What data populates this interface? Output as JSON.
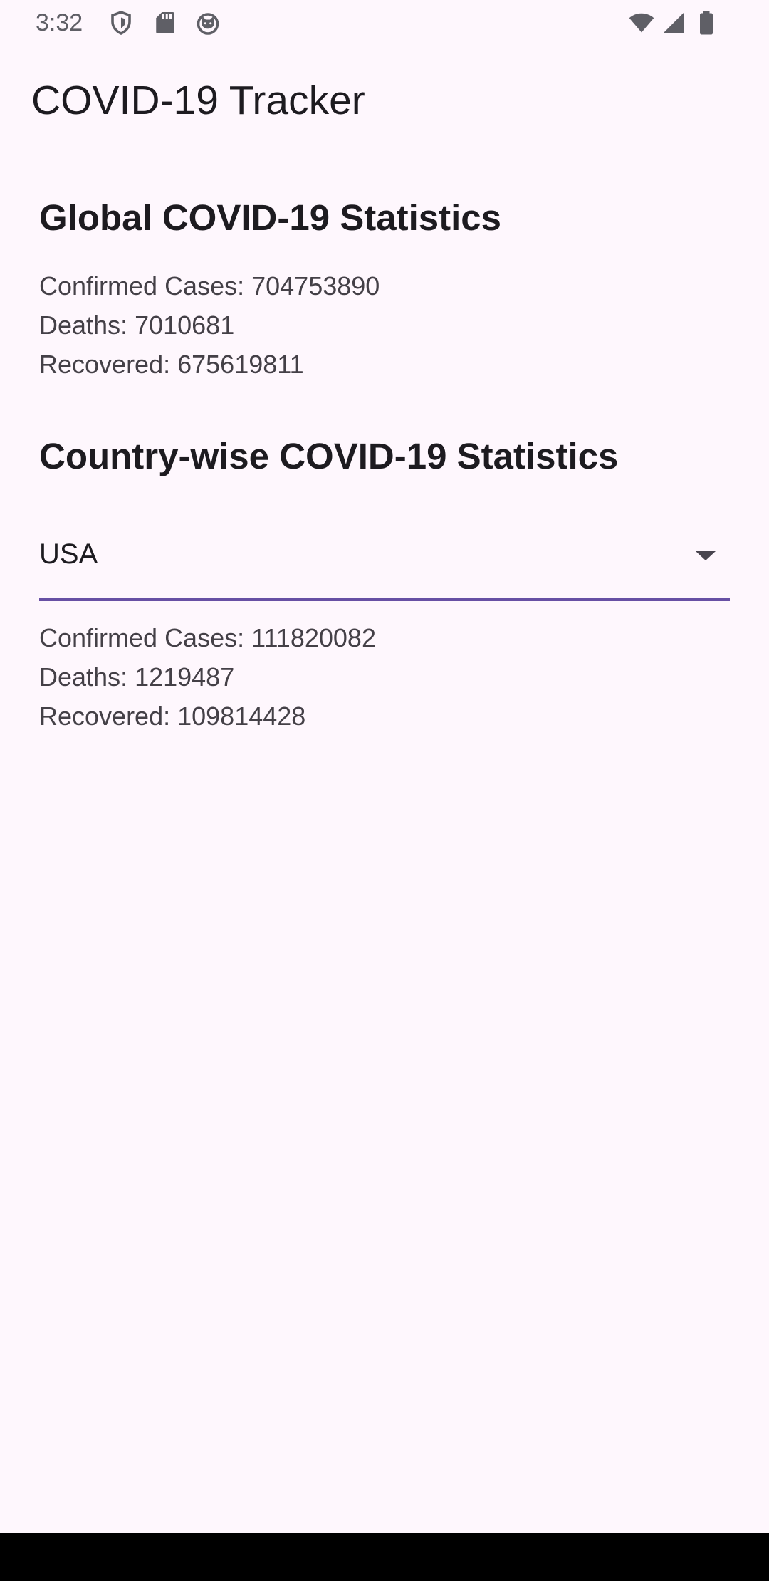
{
  "status_bar": {
    "time": "3:32",
    "icons_left": [
      "shield-icon",
      "sd-card-icon",
      "cat-icon"
    ],
    "icons_right": [
      "wifi-icon",
      "signal-icon",
      "battery-icon"
    ]
  },
  "app_bar": {
    "title": "COVID-19 Tracker"
  },
  "global": {
    "heading": "Global COVID-19 Statistics",
    "confirmed_label": "Confirmed Cases: ",
    "confirmed_value": "704753890",
    "deaths_label": "Deaths: ",
    "deaths_value": "7010681",
    "recovered_label": "Recovered: ",
    "recovered_value": "675619811"
  },
  "country": {
    "heading": "Country-wise COVID-19 Statistics",
    "selected": "USA",
    "confirmed_label": "Confirmed Cases: ",
    "confirmed_value": "111820082",
    "deaths_label": "Deaths: ",
    "deaths_value": "1219487",
    "recovered_label": "Recovered: ",
    "recovered_value": "109814428"
  },
  "colors": {
    "background": "#fef7fd",
    "accent": "#6750a4",
    "text_primary": "#1d1b20",
    "text_secondary": "#444047"
  }
}
